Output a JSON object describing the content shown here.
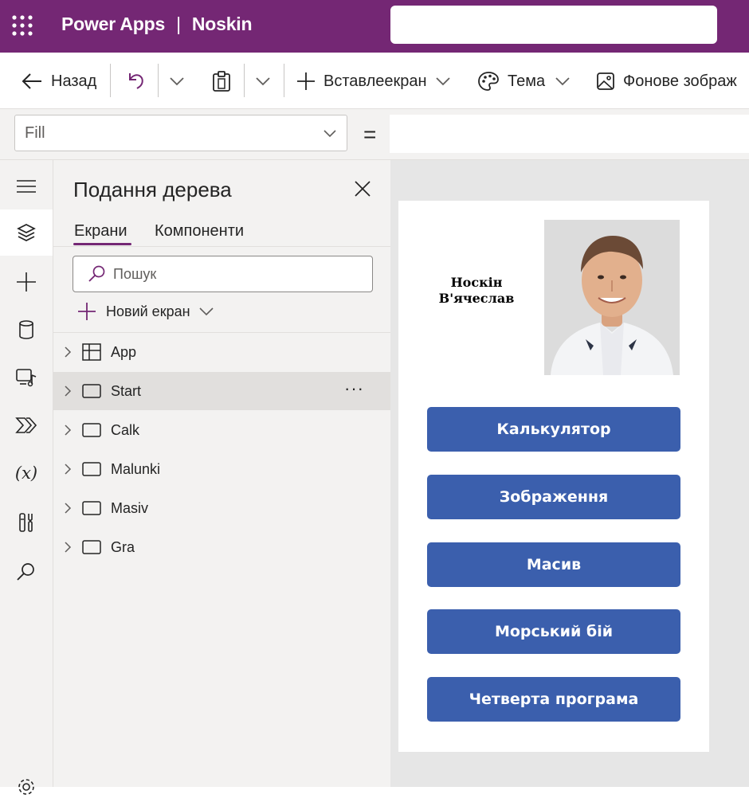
{
  "app": {
    "brand": "Power Apps",
    "separator": "|",
    "project": "Noskin"
  },
  "toolbar": {
    "back": "Назад",
    "insert_screen": "Вставлеекран",
    "theme": "Тема",
    "background_image": "Фонове зображ"
  },
  "formula": {
    "property": "Fill",
    "equals": "="
  },
  "tree": {
    "title": "Подання дерева",
    "tabs": [
      "Екрани",
      "Компоненти"
    ],
    "search_placeholder": "Пошук",
    "new_screen": "Новий екран",
    "items": [
      {
        "name": "App",
        "icon": "app-icon"
      },
      {
        "name": "Start",
        "icon": "screen-icon",
        "selected": true,
        "more": "···"
      },
      {
        "name": "Calk",
        "icon": "screen-icon"
      },
      {
        "name": "Malunki",
        "icon": "screen-icon"
      },
      {
        "name": "Masiv",
        "icon": "screen-icon"
      },
      {
        "name": "Gra",
        "icon": "screen-icon"
      }
    ]
  },
  "screen": {
    "name_line1": "Носкін",
    "name_line2": "В'ячеслав",
    "buttons": [
      "Калькулятор",
      "Зображення",
      "Масив",
      "Морський бій",
      "Четверта програма"
    ]
  },
  "colors": {
    "brand": "#742774",
    "button": "#3b5fad",
    "canvas": "#e6e6e6",
    "panel": "#f3f2f1"
  }
}
